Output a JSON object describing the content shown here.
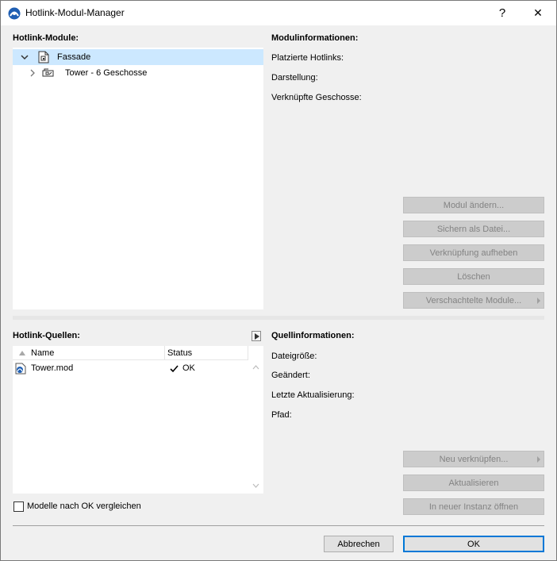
{
  "window": {
    "title": "Hotlink-Modul-Manager",
    "help_label": "?",
    "close_label": "✕"
  },
  "modules": {
    "heading": "Hotlink-Module:",
    "items": [
      {
        "label": "Fassade",
        "expanded": true,
        "selected": true
      },
      {
        "label": "Tower - 6 Geschosse",
        "expanded": false,
        "selected": false
      }
    ]
  },
  "module_info": {
    "heading": "Modulinformationen:",
    "fields": [
      "Platzierte Hotlinks:",
      "Darstellung:",
      "Verknüpfte Geschosse:"
    ],
    "buttons": [
      "Modul ändern...",
      "Sichern als Datei...",
      "Verknüpfung aufheben",
      "Löschen",
      "Verschachtelte Module..."
    ]
  },
  "sources": {
    "heading": "Hotlink-Quellen:",
    "columns": [
      "Name",
      "Status"
    ],
    "rows": [
      {
        "name": "Tower.mod",
        "status_icon": "check-icon",
        "status": "OK"
      }
    ],
    "compare_label": "Modelle nach OK vergleichen",
    "compare_checked": false
  },
  "source_info": {
    "heading": "Quellinformationen:",
    "fields": [
      "Dateigröße:",
      "Geändert:",
      "Letzte Aktualisierung:",
      "Pfad:"
    ],
    "buttons": [
      "Neu verknüpfen...",
      "Aktualisieren",
      "In neuer Instanz öffnen"
    ]
  },
  "footer": {
    "cancel": "Abbrechen",
    "ok": "OK"
  },
  "colors": {
    "selection": "#cce8ff",
    "dialog_bg": "#f0f0f0",
    "disabled_button": "#cccccc",
    "primary_border": "#0078d7"
  }
}
